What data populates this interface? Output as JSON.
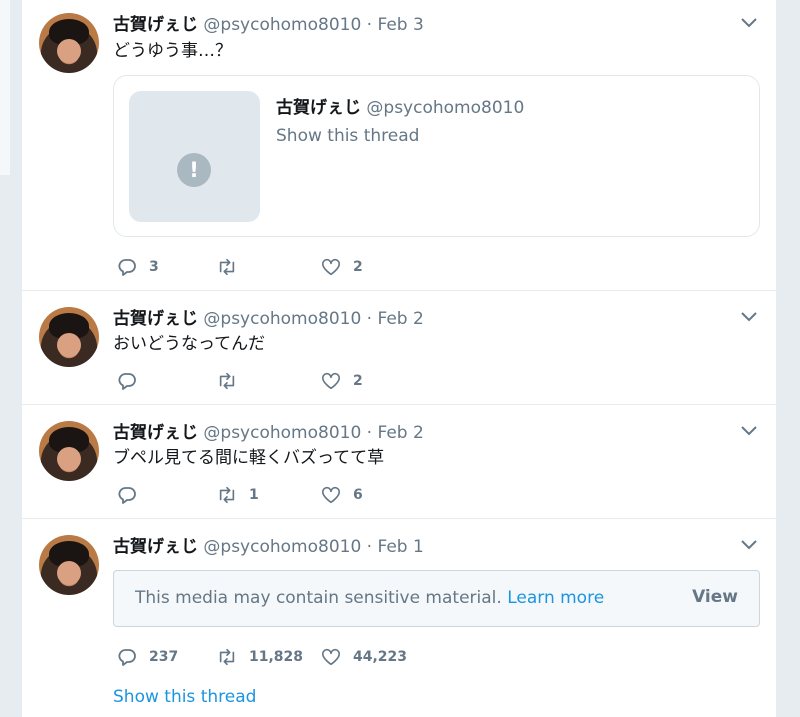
{
  "tweets": [
    {
      "name": "古賀げぇじ",
      "handle": "@psycohomo8010",
      "date": "Feb 3",
      "text": "どうゆう事…？",
      "quote": {
        "name": "古賀げぇじ",
        "handle": "@psycohomo8010",
        "link": "Show this thread",
        "warn_glyph": "!"
      },
      "replies": "3",
      "retweets": "",
      "likes": "2"
    },
    {
      "name": "古賀げぇじ",
      "handle": "@psycohomo8010",
      "date": "Feb 2",
      "text": "おいどうなってんだ",
      "replies": "",
      "retweets": "",
      "likes": "2"
    },
    {
      "name": "古賀げぇじ",
      "handle": "@psycohomo8010",
      "date": "Feb 2",
      "text": "ブペル見てる間に軽くバズってて草",
      "replies": "",
      "retweets": "1",
      "likes": "6"
    },
    {
      "name": "古賀げぇじ",
      "handle": "@psycohomo8010",
      "date": "Feb 1",
      "sensitive": {
        "message": "This media may contain sensitive material.",
        "learn_more": "Learn more",
        "view": "View"
      },
      "replies": "237",
      "retweets": "11,828",
      "likes": "44,223",
      "show_thread": "Show this thread"
    }
  ],
  "separator": "·",
  "icons": {
    "reply": "reply-icon",
    "retweet": "retweet-icon",
    "like": "heart-icon",
    "menu": "chevron-down-icon"
  },
  "colors": {
    "link": "#1b95e0",
    "muted": "#657786",
    "text": "#14171a",
    "border": "#e6ecf0"
  }
}
